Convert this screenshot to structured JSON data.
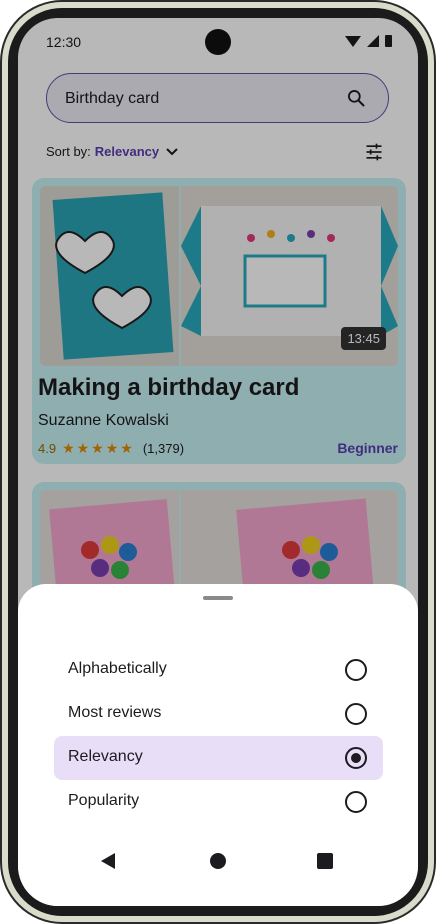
{
  "status_bar": {
    "time": "12:30"
  },
  "search": {
    "value": "Birthday card"
  },
  "sort": {
    "label": "Sort by:",
    "value": "Relevancy"
  },
  "cards": [
    {
      "title": "Making a birthday card",
      "author": "Suzanne Kowalski",
      "rating": "4.9",
      "stars": "★★★★★",
      "reviews": "(1,379)",
      "level": "Beginner",
      "duration": "13:45"
    }
  ],
  "sheet": {
    "options": [
      {
        "label": "Alphabetically",
        "selected": false
      },
      {
        "label": "Most reviews",
        "selected": false
      },
      {
        "label": "Relevancy",
        "selected": true
      },
      {
        "label": "Popularity",
        "selected": false
      }
    ]
  },
  "colors": {
    "accent": "#6750a4",
    "card_bg": "#c7f1f3",
    "selected_bg": "#e8def8",
    "star": "#e18a00"
  }
}
